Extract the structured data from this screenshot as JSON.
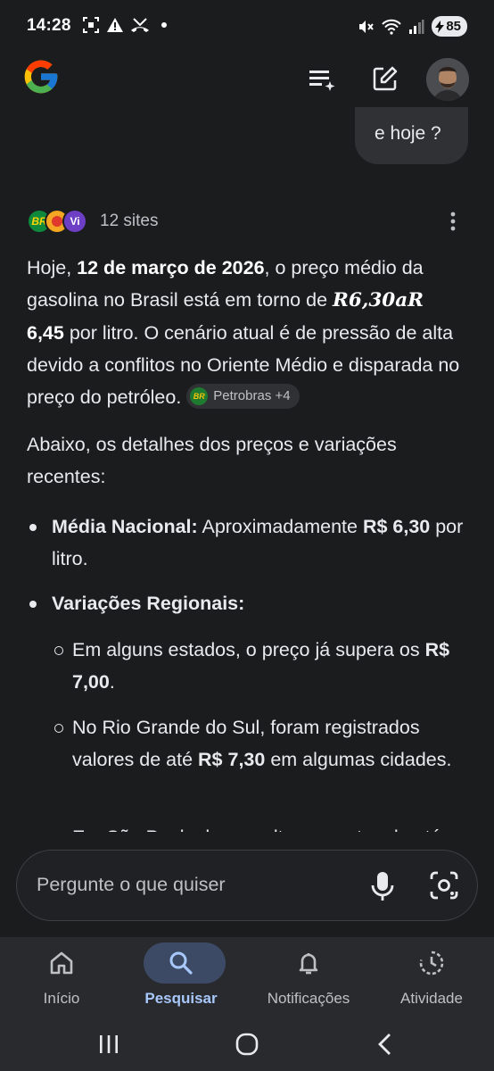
{
  "status": {
    "time": "14:28",
    "battery": "85"
  },
  "conversation": {
    "user_query": "e hoje ?",
    "sources_count": "12 sites",
    "answer": {
      "p1_a": "Hoje, ",
      "p1_date": "12 de março de 2026",
      "p1_b": ", o preço médio da gasolina no Brasil está em torno de ",
      "p1_math": "R6,30aR",
      "p1_price": "6,45",
      "p1_c": " por litro. O cenário atual é de pressão de alta devido a conflitos no Oriente Médio e disparada no preço do petróleo.",
      "chip_label": "Petrobras +4",
      "p2": "Abaixo, os detalhes dos preços e variações recentes:",
      "b1_label": "Média Nacional:",
      "b1_a": " Aproximadamente ",
      "b1_price": "R$ 6,30",
      "b1_b": " por litro.",
      "b2_label": "Variações Regionais:",
      "s1_a": "Em alguns estados, o preço já supera os ",
      "s1_price": "R$ 7,00",
      "s1_b": ".",
      "s2_a": "No Rio Grande do Sul, foram registrados valores de até ",
      "s2_price": "R$ 7,30",
      "s2_b": " em algumas cidades.",
      "s3_a": "Em São Paulo, houve altas recentes de até"
    }
  },
  "ask_box": {
    "placeholder": "Pergunte o que quiser"
  },
  "bottom_nav": {
    "items": [
      {
        "label": "Início",
        "icon": "home-icon"
      },
      {
        "label": "Pesquisar",
        "icon": "search-icon",
        "active": true
      },
      {
        "label": "Notificações",
        "icon": "bell-icon"
      },
      {
        "label": "Atividade",
        "icon": "activity-icon"
      }
    ]
  },
  "colors": {
    "background": "#1b1c1e",
    "active_nav": "#a8c7fa",
    "active_pill": "#3c4a66"
  }
}
